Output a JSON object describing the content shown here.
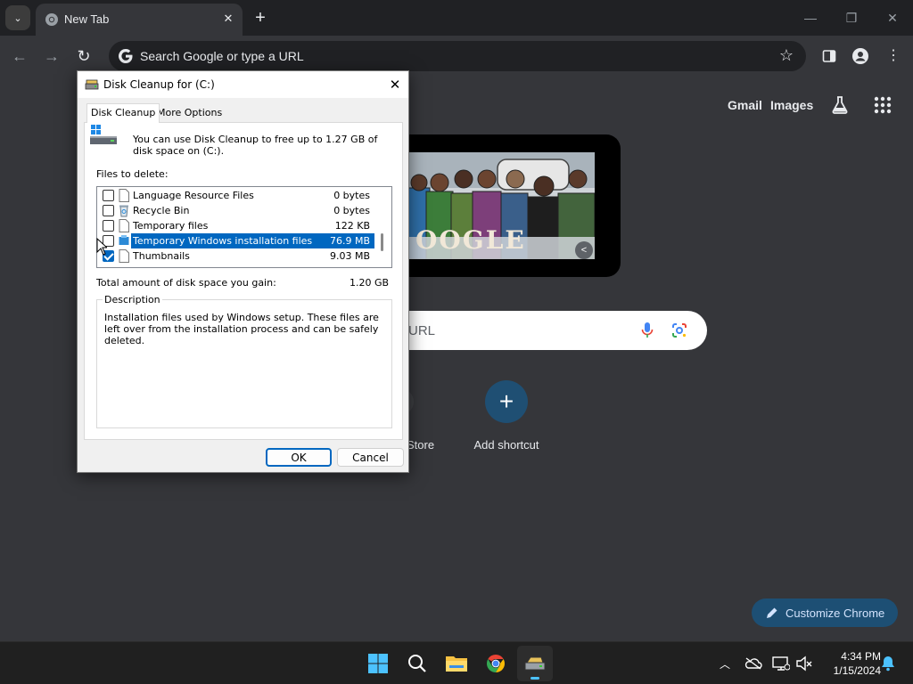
{
  "browser": {
    "tab_title": "New Tab",
    "omnibox_placeholder": "Search Google or type a URL"
  },
  "ntp": {
    "gmail": "Gmail",
    "images": "Images",
    "doodle_word": "OOGLE",
    "search_placeholder_fragment": "URL",
    "store_label_fragment": "Store",
    "add_shortcut_label": "Add shortcut",
    "customize_label": "Customize Chrome"
  },
  "dialog": {
    "title": "Disk Cleanup for  (C:)",
    "tabs": [
      "Disk Cleanup",
      "More Options"
    ],
    "intro": "You can use Disk Cleanup to free up to 1.27 GB of disk space on  (C:).",
    "files_label": "Files to delete:",
    "files": [
      {
        "name": "Language Resource Files",
        "size": "0 bytes",
        "checked": false,
        "selected": false,
        "icon": "file-icon"
      },
      {
        "name": "Recycle Bin",
        "size": "0 bytes",
        "checked": false,
        "selected": false,
        "icon": "recycle-bin-icon"
      },
      {
        "name": "Temporary files",
        "size": "122 KB",
        "checked": false,
        "selected": false,
        "icon": "file-icon"
      },
      {
        "name": "Temporary Windows installation files",
        "size": "76.9 MB",
        "checked": false,
        "selected": true,
        "icon": "setup-icon"
      },
      {
        "name": "Thumbnails",
        "size": "9.03 MB",
        "checked": true,
        "selected": false,
        "icon": "file-icon"
      }
    ],
    "total_label": "Total amount of disk space you gain:",
    "total_value": "1.20 GB",
    "description_legend": "Description",
    "description_text": "Installation files used by Windows setup.  These files are left over from the installation process and can be safely deleted.",
    "ok_label": "OK",
    "cancel_label": "Cancel"
  },
  "taskbar": {
    "time": "4:34 PM",
    "date": "1/15/2024",
    "apps": [
      "start-icon",
      "search-icon",
      "file-explorer-icon",
      "chrome-icon",
      "disk-cleanup-icon"
    ]
  },
  "colors": {
    "chrome_bg": "#35363a",
    "tabstrip_bg": "#202124",
    "accent_blue": "#0067c0",
    "shortcut_blue": "#1f4f73",
    "taskbar_bg": "#202020"
  }
}
